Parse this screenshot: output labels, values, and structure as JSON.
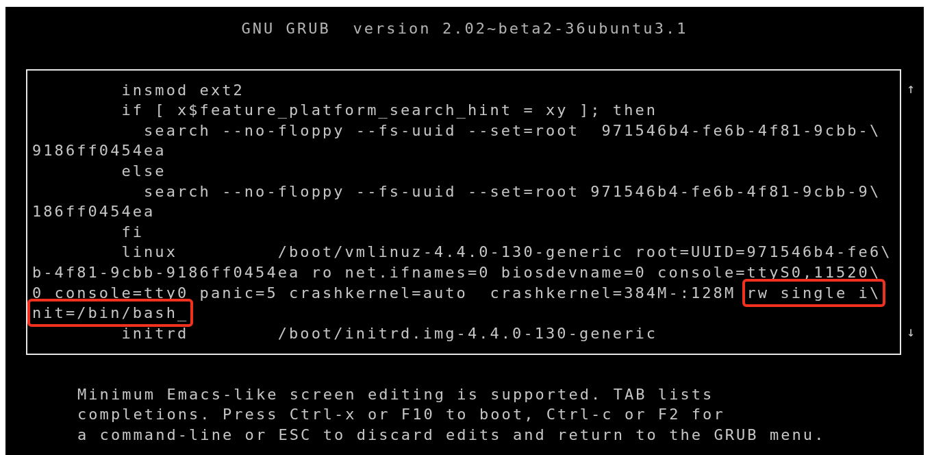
{
  "header": {
    "title": "GNU GRUB  version 2.02~beta2-36ubuntu3.1"
  },
  "editor": {
    "scroll_up": "↑",
    "scroll_down": "↓",
    "lines": [
      {
        "segments": [
          {
            "text": "        insmod ext2",
            "highlighted": false
          }
        ]
      },
      {
        "segments": [
          {
            "text": "        if [ x$feature_platform_search_hint = xy ]; then",
            "highlighted": false
          }
        ]
      },
      {
        "segments": [
          {
            "text": "          search --no-floppy --fs-uuid --set=root  971546b4-fe6b-4f81-9cbb-\\",
            "highlighted": false
          }
        ]
      },
      {
        "segments": [
          {
            "text": "9186ff0454ea",
            "highlighted": false
          }
        ]
      },
      {
        "segments": [
          {
            "text": "        else",
            "highlighted": false
          }
        ]
      },
      {
        "segments": [
          {
            "text": "          search --no-floppy --fs-uuid --set=root 971546b4-fe6b-4f81-9cbb-9\\",
            "highlighted": false
          }
        ]
      },
      {
        "segments": [
          {
            "text": "186ff0454ea",
            "highlighted": false
          }
        ]
      },
      {
        "segments": [
          {
            "text": "        fi",
            "highlighted": false
          }
        ]
      },
      {
        "segments": [
          {
            "text": "        linux         /boot/vmlinuz-4.4.0-130-generic root=UUID=971546b4-fe6\\",
            "highlighted": false
          }
        ]
      },
      {
        "segments": [
          {
            "text": "b-4f81-9cbb-9186ff0454ea ro net.ifnames=0 biosdevname=0 console=ttyS0,11520\\",
            "highlighted": false
          }
        ]
      },
      {
        "segments": [
          {
            "text": "0 console=tty0 panic=5 crashkernel=auto  crashkernel=384M-:128M ",
            "highlighted": false
          },
          {
            "text": "rw single i\\",
            "highlighted": true
          }
        ]
      },
      {
        "segments": [
          {
            "text": "nit=/bin/bash_",
            "highlighted": true
          }
        ]
      },
      {
        "segments": [
          {
            "text": "        initrd        /boot/initrd.img-4.4.0-130-generic",
            "highlighted": false
          }
        ]
      }
    ]
  },
  "help": {
    "lines": [
      "Minimum Emacs-like screen editing is supported. TAB lists",
      "completions. Press Ctrl-x or F10 to boot, Ctrl-c or F2 for",
      "a command-line or ESC to discard edits and return to the GRUB menu."
    ]
  }
}
